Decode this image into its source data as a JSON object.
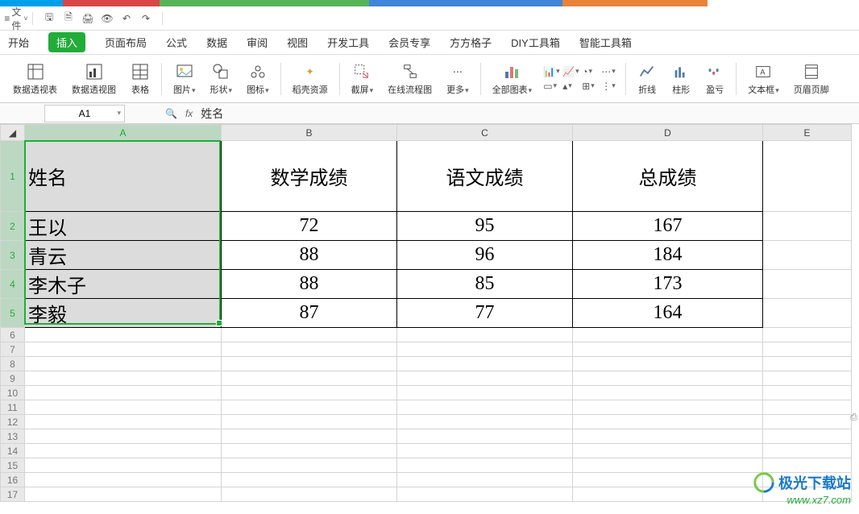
{
  "chart_data": {
    "type": "table",
    "columns": [
      "姓名",
      "数学成绩",
      "语文成绩",
      "总成绩"
    ],
    "rows": [
      {
        "姓名": "王以",
        "数学成绩": 72,
        "语文成绩": 95,
        "总成绩": 167
      },
      {
        "姓名": "青云",
        "数学成绩": 88,
        "语文成绩": 96,
        "总成绩": 184
      },
      {
        "姓名": "李木子",
        "数学成绩": 88,
        "语文成绩": 85,
        "总成绩": 173
      },
      {
        "姓名": "李毅",
        "数学成绩": 87,
        "语文成绩": 77,
        "总成绩": 164
      }
    ]
  },
  "topbar": {
    "file": "文件"
  },
  "ribbon_tabs": {
    "start": "开始",
    "insert": "插入",
    "page": "页面布局",
    "formula": "公式",
    "data": "数据",
    "review": "审阅",
    "view": "视图",
    "dev": "开发工具",
    "member": "会员专享",
    "fgz": "方方格子",
    "diy": "DIY工具箱",
    "smart": "智能工具箱"
  },
  "ribbon_groups": {
    "pivot": "数据透视表",
    "pivotchart": "数据透视图",
    "table": "表格",
    "pic": "图片",
    "shape": "形状",
    "icon": "图标",
    "dock": "稻壳资源",
    "screenshot": "截屏",
    "online": "在线流程图",
    "more": "更多",
    "allchart": "全部图表",
    "line": "折线",
    "bar": "柱形",
    "winloss": "盈亏",
    "textbox": "文本框",
    "header": "页眉页脚"
  },
  "name_box": "A1",
  "formula": "姓名",
  "columns": {
    "A": "A",
    "B": "B",
    "C": "C",
    "D": "D",
    "E": "E"
  },
  "rows": {
    "1": "1",
    "2": "2",
    "3": "3",
    "4": "4",
    "5": "5",
    "6": "6",
    "7": "7",
    "8": "8",
    "9": "9",
    "10": "10",
    "11": "11",
    "12": "12",
    "13": "13",
    "14": "14",
    "15": "15",
    "16": "16",
    "17": "17"
  },
  "headers": {
    "name": "姓名",
    "math": "数学成绩",
    "chinese": "语文成绩",
    "total": "总成绩"
  },
  "data": [
    {
      "name": "王以",
      "math": "72",
      "chinese": "95",
      "total": "167"
    },
    {
      "name": "青云",
      "math": "88",
      "chinese": "96",
      "total": "184"
    },
    {
      "name": "李木子",
      "math": "88",
      "chinese": "85",
      "total": "173"
    },
    {
      "name": "李毅",
      "math": "87",
      "chinese": "77",
      "total": "164"
    }
  ],
  "watermark": {
    "text": "极光下载站",
    "url": "www.xz7.com"
  }
}
